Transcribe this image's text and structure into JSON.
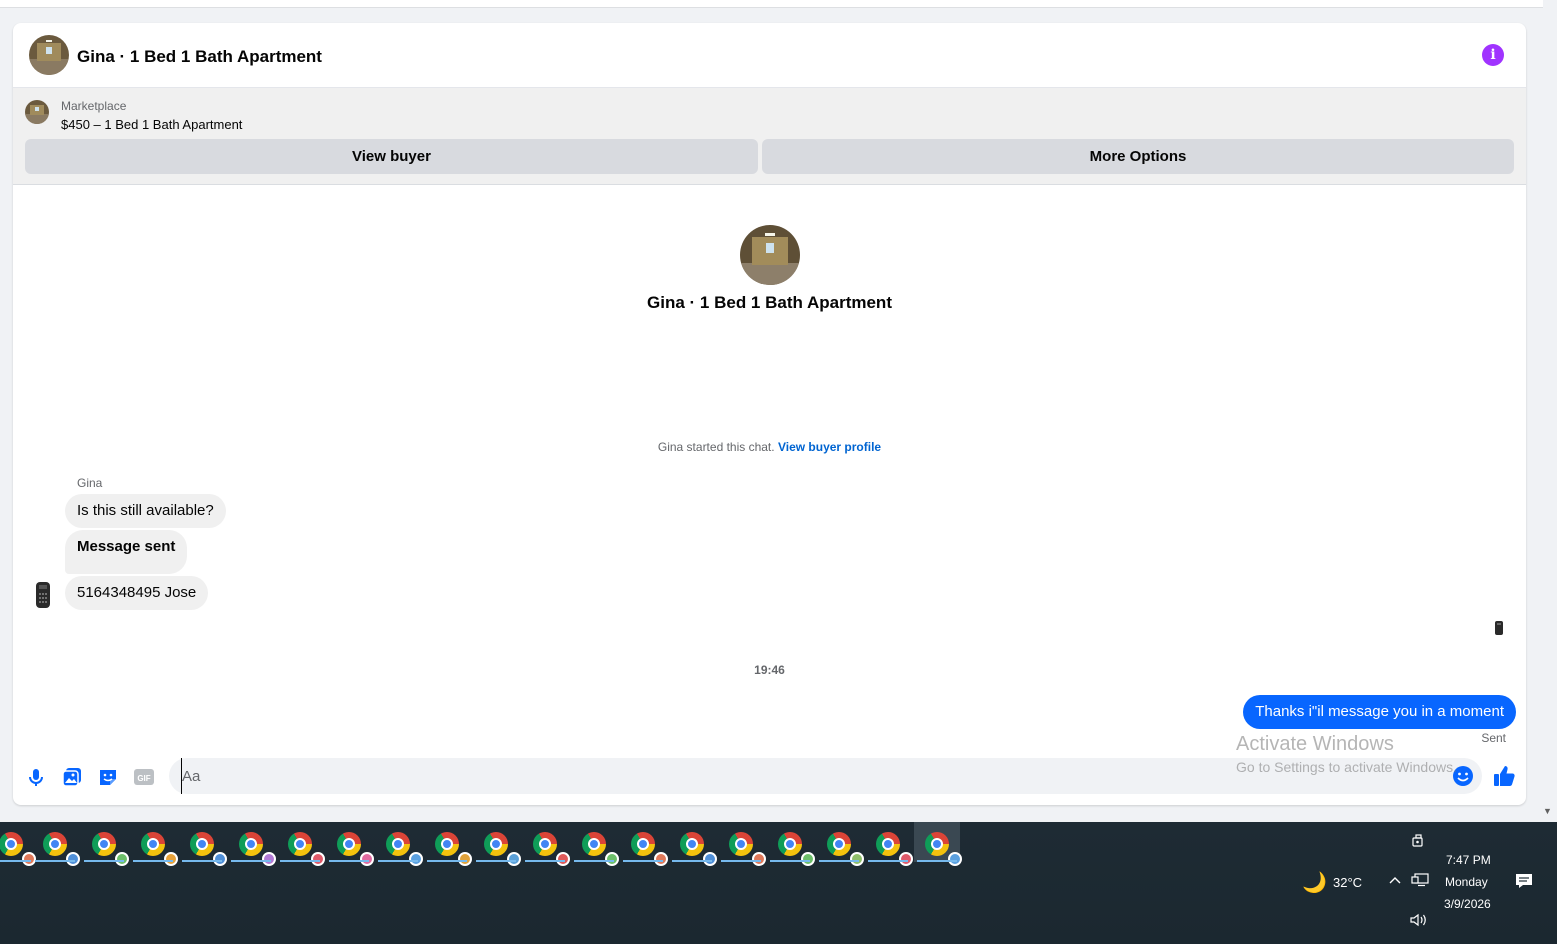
{
  "header": {
    "title": "Gina · 1 Bed 1 Bath Apartment",
    "info_icon": "info-icon"
  },
  "marketplace": {
    "label": "Marketplace",
    "listing": "$450 – 1 Bed 1 Bath Apartment",
    "view_buyer_label": "View buyer",
    "more_options_label": "More Options"
  },
  "conversation": {
    "center_title": "Gina · 1 Bed 1 Bath Apartment",
    "started_text": "Gina started this chat.",
    "started_link": "View buyer profile",
    "sender_name": "Gina",
    "incoming": [
      {
        "text": "Is this still available?"
      },
      {
        "text": "Message sent"
      },
      {
        "text": "5164348495 Jose"
      }
    ],
    "timestamp": "19:46",
    "outgoing": {
      "text": "Thanks i\"il message you in a moment",
      "status": "Sent"
    }
  },
  "watermark": {
    "line1": "Activate Windows",
    "line2": "Go to Settings to activate Windows."
  },
  "composer": {
    "placeholder": "Aa",
    "value": ""
  },
  "colors": {
    "accent": "#0866ff",
    "info": "#a033ff",
    "taskbar": "#1c2a33"
  },
  "taskbar": {
    "apps": [
      {
        "badge": "#e0795a"
      },
      {
        "badge": "#4f8fd8"
      },
      {
        "badge": "#6dbf6a"
      },
      {
        "badge": "#e8a23a"
      },
      {
        "badge": "#4f8fd8"
      },
      {
        "badge": "#b27ad6"
      },
      {
        "badge": "#e05a6a"
      },
      {
        "badge": "#e06aa0"
      },
      {
        "badge": "#5aa0e0"
      },
      {
        "badge": "#e0a23a"
      },
      {
        "badge": "#5aa0d8"
      },
      {
        "badge": "#e05a5a"
      },
      {
        "badge": "#6dbf6a"
      },
      {
        "badge": "#e0795a"
      },
      {
        "badge": "#4f8fd8"
      },
      {
        "badge": "#e0795a"
      },
      {
        "badge": "#6dbf6a"
      },
      {
        "badge": "#8fbf6a"
      },
      {
        "badge": "#e05a6a"
      },
      {
        "badge": "#5aa0e0"
      }
    ],
    "temperature": "32°C",
    "time": "7:47 PM",
    "day": "Monday",
    "date": "3/9/2026"
  }
}
